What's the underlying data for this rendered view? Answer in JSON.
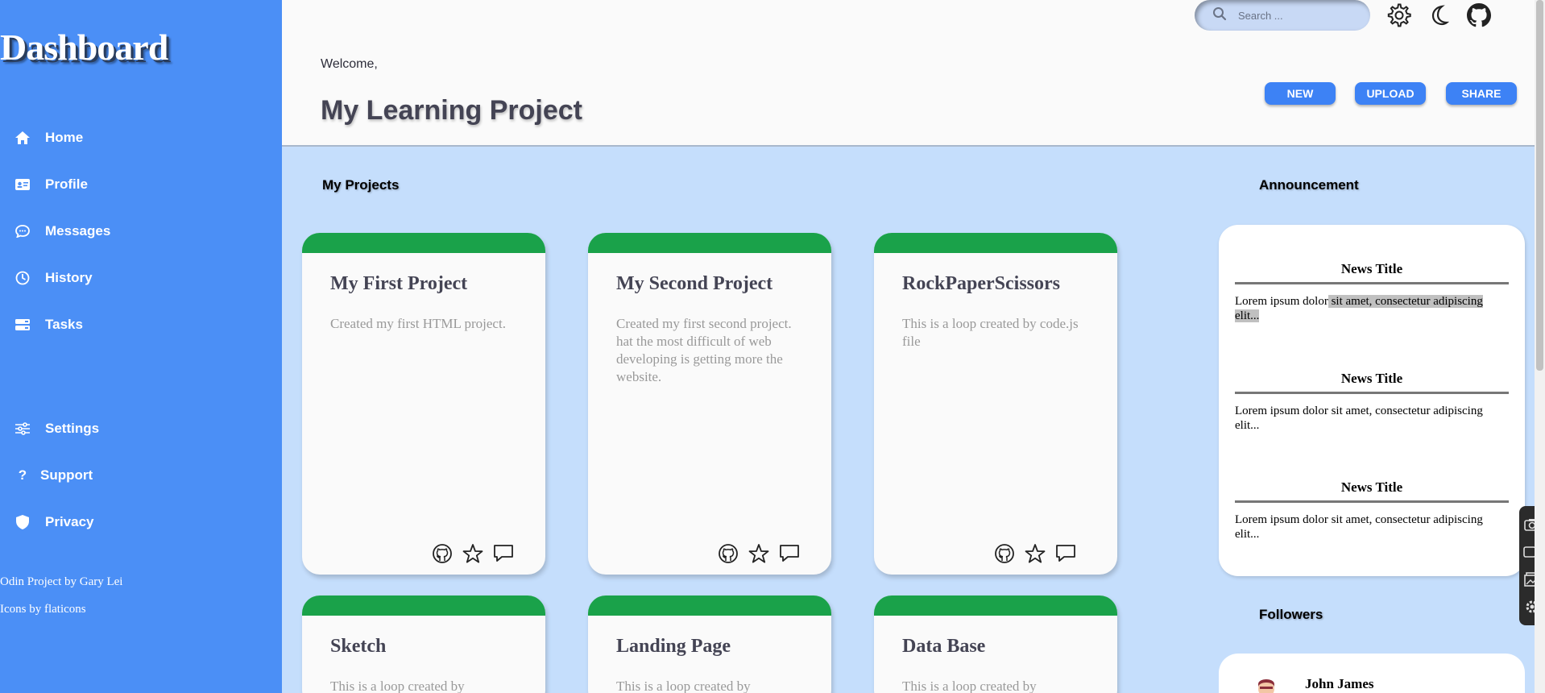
{
  "sidebar": {
    "logo": "Dashboard",
    "items": [
      {
        "label": "Home",
        "icon": "home-icon"
      },
      {
        "label": "Profile",
        "icon": "id-card-icon"
      },
      {
        "label": "Messages",
        "icon": "chat-icon"
      },
      {
        "label": "History",
        "icon": "clock-icon"
      },
      {
        "label": "Tasks",
        "icon": "tasks-icon"
      },
      {
        "label": "Settings",
        "icon": "sliders-icon"
      },
      {
        "label": "Support",
        "icon": "question-icon"
      },
      {
        "label": "Privacy",
        "icon": "shield-icon"
      }
    ],
    "credits": [
      "Odin Project by Gary Lei",
      "Icons by flaticons"
    ]
  },
  "header": {
    "welcome": "Welcome,",
    "title": "My Learning Project",
    "search_placeholder": "Search ...",
    "buttons": [
      "NEW",
      "UPLOAD",
      "SHARE"
    ],
    "icons": [
      "gear-icon",
      "moon-icon",
      "github-icon"
    ]
  },
  "projects": {
    "section_title": "My Projects",
    "cards": [
      {
        "title": "My First Project",
        "desc": "Created my first HTML project."
      },
      {
        "title": "My Second Project",
        "desc": "Created my first second project. hat the most difficult of web developing is getting more the website."
      },
      {
        "title": "RockPaperScissors",
        "desc": "This is a loop created by code.js file"
      },
      {
        "title": "Sketch",
        "desc": "This is a loop created by"
      },
      {
        "title": "Landing Page",
        "desc": "This is a loop created by"
      },
      {
        "title": "Data Base",
        "desc": "This is a loop created by"
      }
    ]
  },
  "announcement": {
    "section_title": "Announcement",
    "news": [
      {
        "title": "News Title",
        "body_pre": "Lorem ipsum dolor",
        "body_hl": " sit amet, consectetur adipiscing elit..."
      },
      {
        "title": "News Title",
        "body": "Lorem ipsum dolor sit amet, consectetur adipiscing elit..."
      },
      {
        "title": "News Title",
        "body": "Lorem ipsum dolor sit amet, consectetur adipiscing elit..."
      }
    ]
  },
  "followers": {
    "section_title": "Followers",
    "items": [
      {
        "name": "John James"
      }
    ]
  },
  "colors": {
    "sidebar": "#4b8ff6",
    "background": "#c5defc",
    "card_bar": "#1aa24a",
    "button": "#3d82f5"
  }
}
